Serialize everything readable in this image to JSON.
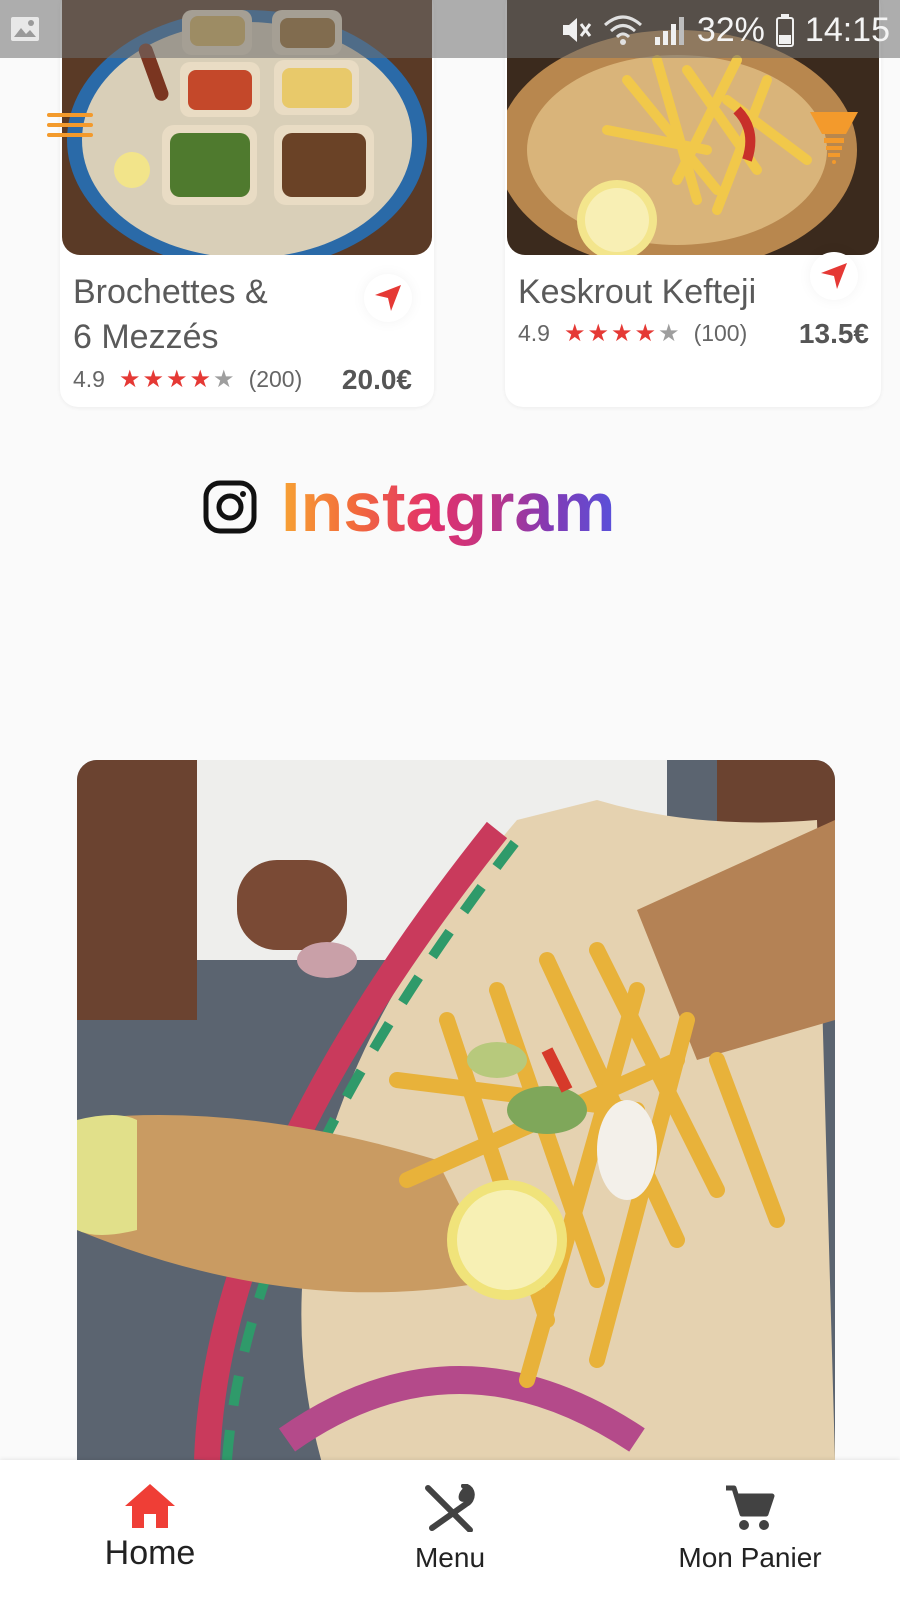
{
  "status_bar": {
    "battery": "32%",
    "time": "14:15"
  },
  "products": [
    {
      "title": "Brochettes &\n 6 Mezzés",
      "rating": "4.9",
      "stars_filled": 4,
      "stars_total": 5,
      "reviews": "(200)",
      "price": "20.0€"
    },
    {
      "title": "Keskrout Kefteji",
      "rating": "4.9",
      "stars_filled": 4,
      "stars_total": 5,
      "reviews": "(100)",
      "price": "13.5€"
    }
  ],
  "instagram": {
    "label": "Instagram"
  },
  "bottom_nav": {
    "items": [
      {
        "label": "Home",
        "icon": "home-icon",
        "active": true
      },
      {
        "label": "Menu",
        "icon": "fork-knife-icon",
        "active": false
      },
      {
        "label": "Mon Panier",
        "icon": "cart-icon",
        "active": false
      }
    ]
  },
  "colors": {
    "accent_red": "#e53935",
    "accent_orange": "#f39a2c",
    "star_off": "#9e9e9e"
  }
}
